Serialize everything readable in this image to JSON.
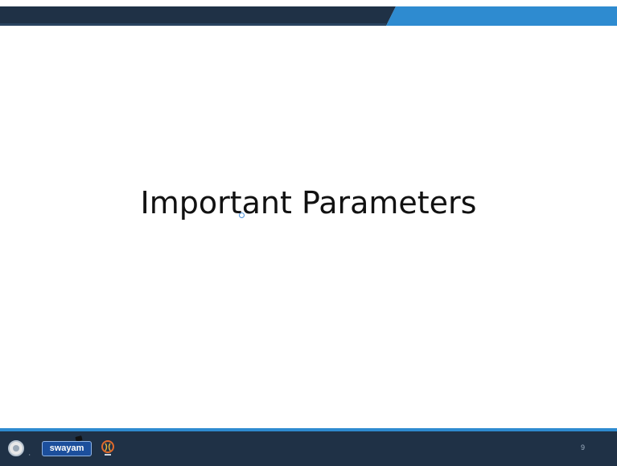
{
  "slide": {
    "title": "Important Parameters",
    "page_number": "9"
  },
  "footer": {
    "logos": [
      "institute-seal",
      "swayam",
      "nptel"
    ],
    "swayam_label": "swayam"
  },
  "colors": {
    "top_band_dark": "#1f3146",
    "top_band_accent": "#2e8bd0",
    "footer_background": "#1f3146",
    "footer_line": "#2e8bd0",
    "title_text": "#111111"
  }
}
